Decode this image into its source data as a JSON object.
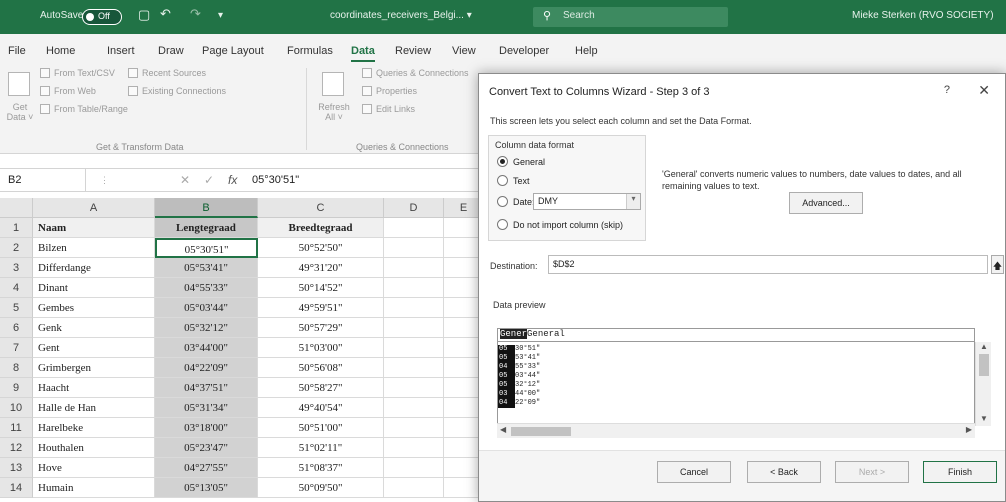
{
  "titlebar": {
    "autosave_label": "AutoSave",
    "autosave_state": "Off",
    "filename": "coordinates_receivers_Belgi... ▾",
    "search_placeholder": "Search",
    "user": "Mieke Sterken (RVO SOCIETY)",
    "qat_icons": [
      "save-icon",
      "undo-icon",
      "redo-icon",
      "customize-icon"
    ]
  },
  "ribbon_tabs": [
    "File",
    "Home",
    "Insert",
    "Draw",
    "Page Layout",
    "Formulas",
    "Data",
    "Review",
    "View",
    "Developer",
    "Help"
  ],
  "active_tab": "Data",
  "ribbon": {
    "get_data_label": "Get Data ˅",
    "from_text_csv": "From Text/CSV",
    "from_web": "From Web",
    "from_table_range": "From Table/Range",
    "recent_sources": "Recent Sources",
    "existing_connections": "Existing Connections",
    "group1_label": "Get & Transform Data",
    "refresh_all": "Refresh All ˅",
    "queries_connections": "Queries & Connections",
    "properties": "Properties",
    "edit_links": "Edit Links",
    "group2_label": "Queries & Connections"
  },
  "formula_bar": {
    "name_box": "B2",
    "cancel_symbol": "✕",
    "enter_symbol": "✓",
    "fx_symbol": "fx",
    "value": "05°30'51\""
  },
  "sheet": {
    "columns": [
      "A",
      "B",
      "C",
      "D",
      "E"
    ],
    "rows": [
      {
        "num": "1",
        "a": "Naam",
        "b": "Lengtegraad",
        "c": "Breedtegraad"
      },
      {
        "num": "2",
        "a": "Bilzen",
        "b": "05°30'51\"",
        "c": "50°52'50\""
      },
      {
        "num": "3",
        "a": "Differdange",
        "b": "05°53'41\"",
        "c": "49°31'20\""
      },
      {
        "num": "4",
        "a": "Dinant",
        "b": "04°55'33\"",
        "c": "50°14'52\""
      },
      {
        "num": "5",
        "a": "Gembes",
        "b": "05°03'44\"",
        "c": "49°59'51\""
      },
      {
        "num": "6",
        "a": "Genk",
        "b": "05°32'12\"",
        "c": "50°57'29\""
      },
      {
        "num": "7",
        "a": "Gent",
        "b": "03°44'00\"",
        "c": "51°03'00\""
      },
      {
        "num": "8",
        "a": "Grimbergen",
        "b": "04°22'09\"",
        "c": "50°56'08\""
      },
      {
        "num": "9",
        "a": "Haacht",
        "b": "04°37'51\"",
        "c": "50°58'27\""
      },
      {
        "num": "10",
        "a": "Halle de Han",
        "b": "05°31'34\"",
        "c": "49°40'54\""
      },
      {
        "num": "11",
        "a": "Harelbeke",
        "b": "03°18'00\"",
        "c": "50°51'00\""
      },
      {
        "num": "12",
        "a": "Houthalen",
        "b": "05°23'47\"",
        "c": "51°02'11\""
      },
      {
        "num": "13",
        "a": "Hove",
        "b": "04°27'55\"",
        "c": "51°08'37\""
      },
      {
        "num": "14",
        "a": "Humain",
        "b": "05°13'05\"",
        "c": "50°09'50\""
      }
    ]
  },
  "dialog": {
    "title": "Convert Text to Columns Wizard - Step 3 of 3",
    "help": "?",
    "close": "✕",
    "description": "This screen lets you select each column and set the Data Format.",
    "format_legend": "Column data format",
    "options": {
      "general": "General",
      "text": "Text",
      "date": "Date:",
      "skip": "Do not import column (skip)"
    },
    "date_value": "DMY",
    "hint": "'General' converts numeric values to numbers, date values to dates, and all remaining values to text.",
    "advanced": "Advanced...",
    "destination_label": "Destination:",
    "destination_value": "$D$2",
    "preview_label": "Data preview",
    "preview_header_1": "Gener",
    "preview_header_2": "General",
    "preview_rows": [
      {
        "c1": "05",
        "c2": "30°51\""
      },
      {
        "c1": "05",
        "c2": "53°41\""
      },
      {
        "c1": "04",
        "c2": "55°33\""
      },
      {
        "c1": "05",
        "c2": "03°44\""
      },
      {
        "c1": "05",
        "c2": "32°12\""
      },
      {
        "c1": "03",
        "c2": "44°00\""
      },
      {
        "c1": "04",
        "c2": "22°09\""
      }
    ],
    "buttons": {
      "cancel": "Cancel",
      "back": "< Back",
      "next": "Next >",
      "finish": "Finish"
    }
  }
}
